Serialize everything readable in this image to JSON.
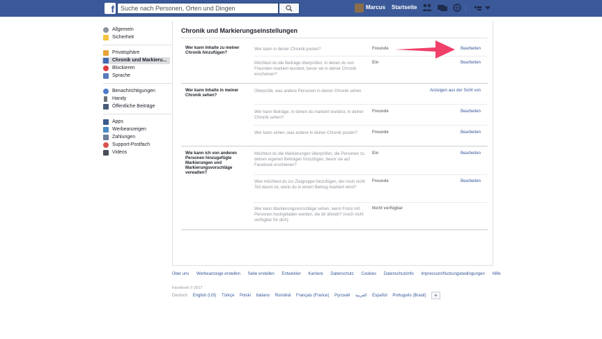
{
  "topbar": {
    "search_placeholder": "Suche nach Personen, Orten und Dingen",
    "user_name": "Marcus",
    "home_label": "Startseite"
  },
  "colors": {
    "brand": "#3b5998",
    "link": "#365899",
    "arrow": "#f0406a"
  },
  "sidebar": {
    "groups": [
      [
        {
          "label": "Allgemein",
          "icon": "gear-icon"
        },
        {
          "label": "Sicherheit",
          "icon": "shield-icon"
        }
      ],
      [
        {
          "label": "Privatsphäre",
          "icon": "lock-icon"
        },
        {
          "label": "Chronik und Markieru...",
          "icon": "timeline-icon",
          "active": true
        },
        {
          "label": "Blockieren",
          "icon": "block-icon"
        },
        {
          "label": "Sprache",
          "icon": "language-icon"
        }
      ],
      [
        {
          "label": "Benachrichtigungen",
          "icon": "globe-icon"
        },
        {
          "label": "Handy",
          "icon": "phone-icon"
        },
        {
          "label": "Öffentliche Beiträge",
          "icon": "rss-icon"
        }
      ],
      [
        {
          "label": "Apps",
          "icon": "apps-icon"
        },
        {
          "label": "Werbeanzeigen",
          "icon": "ads-icon"
        },
        {
          "label": "Zahlungen",
          "icon": "card-icon"
        },
        {
          "label": "Support-Postfach",
          "icon": "support-icon"
        },
        {
          "label": "Videos",
          "icon": "video-icon"
        }
      ]
    ]
  },
  "main": {
    "title": "Chronik und Markierungseinstellungen",
    "sections": [
      {
        "title": "Wer kann Inhalte zu meiner Chronik hinzufügen?",
        "rows": [
          {
            "question": "Wer kann in deiner Chronik posten?",
            "value": "Freunde",
            "action": "Bearbeiten"
          },
          {
            "question": "Möchtest du die Beiträge überprüfen, in denen du von Freunden markiert wurdest, bevor sie in deiner Chronik erscheinen?",
            "value": "Ein",
            "action": "Bearbeiten"
          }
        ]
      },
      {
        "title": "Wer kann Inhalte in meiner Chronik sehen?",
        "rows": [
          {
            "question": "Überprüfe, was andere Personen in deiner Chronik sehen",
            "value": "",
            "action": "Anzeigen aus der Sicht von"
          },
          {
            "question": "Wer kann Beiträge, in denen du markiert wurdest, in deiner Chronik sehen?",
            "value": "Freunde",
            "action": "Bearbeiten"
          },
          {
            "question": "Wer kann sehen, was andere in deiner Chronik posten?",
            "value": "Freunde",
            "action": "Bearbeiten"
          }
        ]
      },
      {
        "title": "Wie kann ich von anderen Personen hinzugefügte Markierungen und Markierungsvorschläge verwalten?",
        "rows": [
          {
            "question": "Möchtest du die Markierungen überprüfen, die Personen zu deinen eigenen Beiträgen hinzufügen, bevor sie auf Facebook erscheinen?",
            "value": "Ein",
            "action": "Bearbeiten"
          },
          {
            "question": "Wen möchtest du zur Zielgruppe hinzufügen, der noch nicht Teil davon ist, wenn du in einem Beitrag markiert wirst?",
            "value": "Freunde",
            "action": "Bearbeiten"
          },
          {
            "question": "Wer kann Markierungsvorschläge sehen, wenn Fotos mit Personen hochgeladen werden, die dir ähneln? (noch nicht verfügbar für dich)",
            "value": "Nicht verfügbar",
            "action": ""
          }
        ]
      }
    ]
  },
  "footer": {
    "links": [
      "Über uns",
      "Werbeanzeige erstellen",
      "Seite erstellen",
      "Entwickler",
      "Karriere",
      "Datenschutz",
      "Cookies",
      "Datenschutzinfo",
      "Impressum/Nutzungsbedingungen",
      "Hilfe"
    ],
    "copyright": "Facebook © 2017",
    "current_language": "Deutsch",
    "languages": [
      "English (US)",
      "Türkçe",
      "Polski",
      "Italiano",
      "Română",
      "Français (France)",
      "Русский",
      "العربية",
      "Español",
      "Português (Brasil)"
    ],
    "more_label": "+"
  }
}
